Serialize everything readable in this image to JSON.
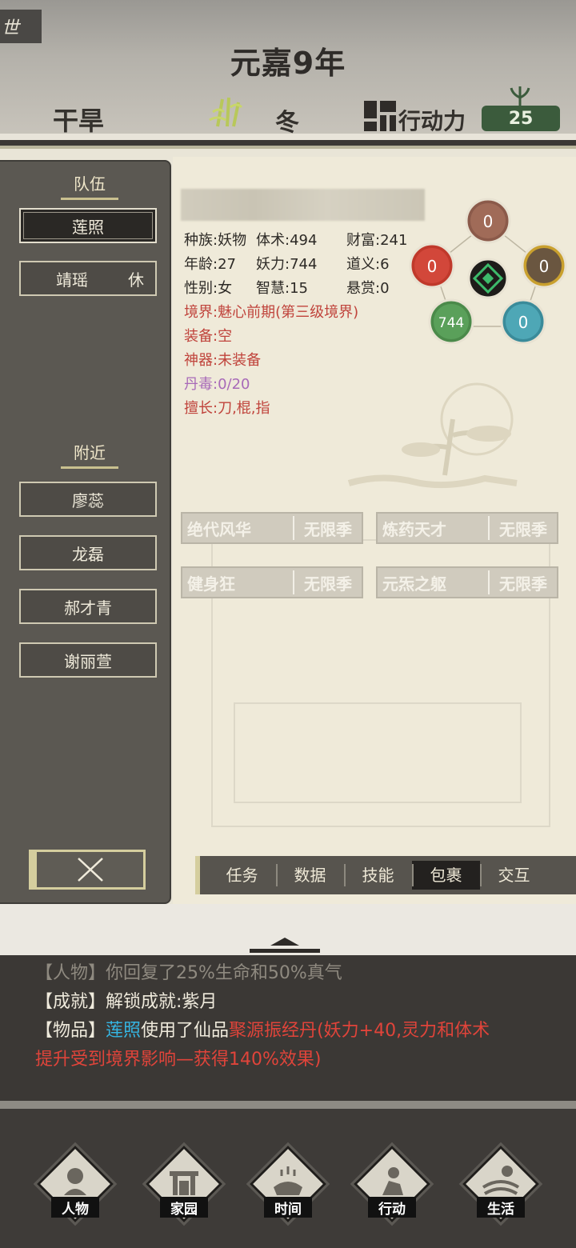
{
  "header": {
    "corner_tag": "世",
    "year": "元嘉9年",
    "weather": "干旱",
    "season": "冬",
    "action_label": "行动力",
    "action_points": "25"
  },
  "sidebar": {
    "team_title": "队伍",
    "team": [
      {
        "name": "莲照",
        "tag": ""
      },
      {
        "name": "靖瑶",
        "tag": "休"
      }
    ],
    "nearby_title": "附近",
    "nearby": [
      "廖蕊",
      "龙磊",
      "郝才青",
      "谢丽萱"
    ]
  },
  "stats": {
    "race": "种族:妖物",
    "body": "体术:494",
    "wealth": "财富:241",
    "age": "年龄:27",
    "demon_power": "妖力:744",
    "morality": "道义:6",
    "gender": "性别:女",
    "wisdom": "智慧:15",
    "bounty": "悬赏:0",
    "realm": "境界:魅心前期(第三级境界)",
    "equipment": "装备:空",
    "artifact": "神器:未装备",
    "poison": "丹毒:0/20",
    "specialty": "擅长:刀,棍,指"
  },
  "elements": {
    "top": "0",
    "left": "0",
    "right": "0",
    "bottom_left": "744",
    "bottom_right": "0"
  },
  "traits": [
    {
      "name": "绝代风华",
      "duration": "无限季"
    },
    {
      "name": "炼药天才",
      "duration": "无限季"
    },
    {
      "name": "健身狂",
      "duration": "无限季"
    },
    {
      "name": "元炁之躯",
      "duration": "无限季"
    }
  ],
  "tabs": [
    "任务",
    "数据",
    "技能",
    "包裹",
    "交互"
  ],
  "active_tab": "包裹",
  "log": {
    "line0": "【人物】你回复了25%生命和50%真气",
    "line1": "【成就】解锁成就:紫月",
    "line2_prefix": "【物品】",
    "line2_name": "莲照",
    "line2_mid": "使用了仙品",
    "line2_item": "聚源振经丹",
    "line2_effect": "(妖力+40,灵力和体术",
    "line3": "提升受到境界影响—获得140%效果)"
  },
  "nav": [
    "人物",
    "家园",
    "时间",
    "行动",
    "生活"
  ],
  "colors": {
    "accent_green": "#3b5b3c",
    "realm_red": "#c0443c",
    "poison_purple": "#a86ab8",
    "log_cyan": "#35b6e3",
    "log_red": "#e0443a"
  }
}
